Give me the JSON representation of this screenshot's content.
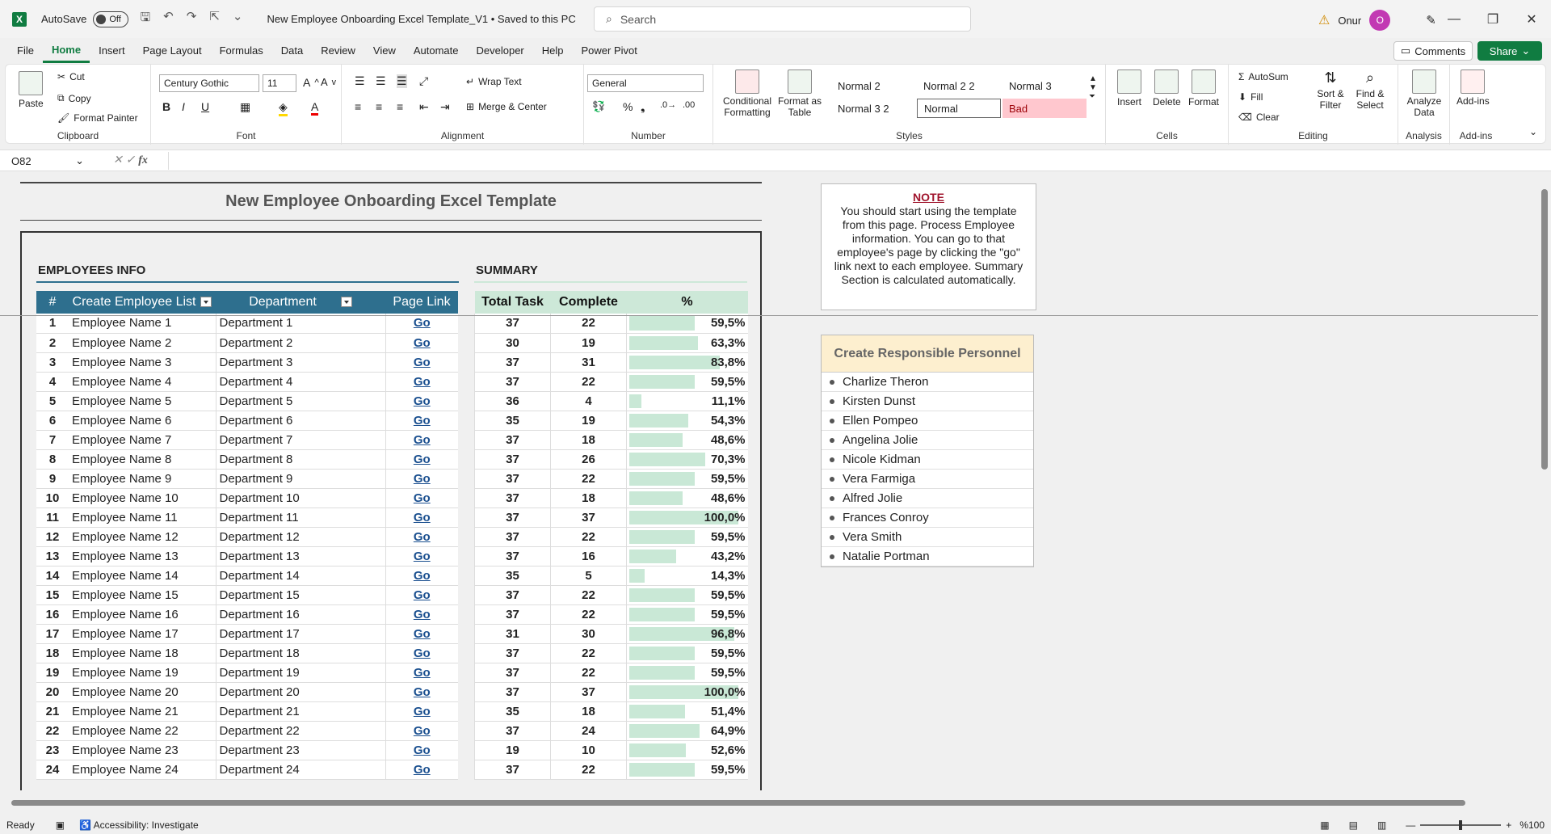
{
  "app": {
    "autosave_label": "AutoSave",
    "autosave_state": "Off",
    "doc_title": "New Employee Onboarding Excel Template_V1 • Saved to this PC",
    "search_placeholder": "Search",
    "user_name": "Onur",
    "user_initial": "O"
  },
  "menu": [
    "File",
    "Home",
    "Insert",
    "Page Layout",
    "Formulas",
    "Data",
    "Review",
    "View",
    "Automate",
    "Developer",
    "Help",
    "Power Pivot"
  ],
  "buttons": {
    "comments": "Comments",
    "share": "Share"
  },
  "ribbon": {
    "clipboard": {
      "label": "Clipboard",
      "paste": "Paste",
      "cut": "Cut",
      "copy": "Copy",
      "format_painter": "Format Painter"
    },
    "font": {
      "label": "Font",
      "family": "Century Gothic",
      "size": "11"
    },
    "alignment": {
      "label": "Alignment",
      "wrap": "Wrap Text",
      "merge": "Merge & Center"
    },
    "number": {
      "label": "Number",
      "format": "General"
    },
    "styles": {
      "label": "Styles",
      "conditional": "Conditional Formatting",
      "format_table": "Format as Table",
      "items": [
        "Normal 2",
        "Normal 2 2",
        "Normal 3",
        "Normal 3 2",
        "Normal",
        "Bad"
      ]
    },
    "cells": {
      "label": "Cells",
      "insert": "Insert",
      "delete": "Delete",
      "format": "Format"
    },
    "editing": {
      "label": "Editing",
      "autosum": "AutoSum",
      "fill": "Fill",
      "clear": "Clear",
      "sort": "Sort & Filter",
      "find": "Find & Select"
    },
    "analysis": {
      "label": "Analysis",
      "analyze": "Analyze Data"
    },
    "addins": {
      "label": "Add-ins",
      "addins": "Add-ins"
    }
  },
  "formula": {
    "cell_ref": "O82",
    "fx": "fx"
  },
  "sheet": {
    "title": "New Employee Onboarding Excel Template",
    "employees_title": "EMPLOYEES INFO",
    "summary_title": "SUMMARY",
    "emp_headers": [
      "#",
      "Create Employee List",
      "Department",
      "Page Link"
    ],
    "sum_headers": [
      "Total Task",
      "Complete",
      "%"
    ],
    "rows": [
      {
        "n": "1",
        "name": "Employee Name 1",
        "dept": "Department 1",
        "link": "Go",
        "total": "37",
        "complete": "22",
        "pct": "59,5%",
        "frac": 0.595
      },
      {
        "n": "2",
        "name": "Employee Name 2",
        "dept": "Department 2",
        "link": "Go",
        "total": "30",
        "complete": "19",
        "pct": "63,3%",
        "frac": 0.633
      },
      {
        "n": "3",
        "name": "Employee Name 3",
        "dept": "Department 3",
        "link": "Go",
        "total": "37",
        "complete": "31",
        "pct": "83,8%",
        "frac": 0.838
      },
      {
        "n": "4",
        "name": "Employee Name 4",
        "dept": "Department 4",
        "link": "Go",
        "total": "37",
        "complete": "22",
        "pct": "59,5%",
        "frac": 0.595
      },
      {
        "n": "5",
        "name": "Employee Name 5",
        "dept": "Department 5",
        "link": "Go",
        "total": "36",
        "complete": "4",
        "pct": "11,1%",
        "frac": 0.111
      },
      {
        "n": "6",
        "name": "Employee Name 6",
        "dept": "Department 6",
        "link": "Go",
        "total": "35",
        "complete": "19",
        "pct": "54,3%",
        "frac": 0.543
      },
      {
        "n": "7",
        "name": "Employee Name 7",
        "dept": "Department 7",
        "link": "Go",
        "total": "37",
        "complete": "18",
        "pct": "48,6%",
        "frac": 0.486
      },
      {
        "n": "8",
        "name": "Employee Name 8",
        "dept": "Department 8",
        "link": "Go",
        "total": "37",
        "complete": "26",
        "pct": "70,3%",
        "frac": 0.703
      },
      {
        "n": "9",
        "name": "Employee Name 9",
        "dept": "Department 9",
        "link": "Go",
        "total": "37",
        "complete": "22",
        "pct": "59,5%",
        "frac": 0.595
      },
      {
        "n": "10",
        "name": "Employee Name 10",
        "dept": "Department 10",
        "link": "Go",
        "total": "37",
        "complete": "18",
        "pct": "48,6%",
        "frac": 0.486
      },
      {
        "n": "11",
        "name": "Employee Name 11",
        "dept": "Department 11",
        "link": "Go",
        "total": "37",
        "complete": "37",
        "pct": "100,0%",
        "frac": 1.0
      },
      {
        "n": "12",
        "name": "Employee Name 12",
        "dept": "Department 12",
        "link": "Go",
        "total": "37",
        "complete": "22",
        "pct": "59,5%",
        "frac": 0.595
      },
      {
        "n": "13",
        "name": "Employee Name 13",
        "dept": "Department 13",
        "link": "Go",
        "total": "37",
        "complete": "16",
        "pct": "43,2%",
        "frac": 0.432
      },
      {
        "n": "14",
        "name": "Employee Name 14",
        "dept": "Department 14",
        "link": "Go",
        "total": "35",
        "complete": "5",
        "pct": "14,3%",
        "frac": 0.143
      },
      {
        "n": "15",
        "name": "Employee Name 15",
        "dept": "Department 15",
        "link": "Go",
        "total": "37",
        "complete": "22",
        "pct": "59,5%",
        "frac": 0.595
      },
      {
        "n": "16",
        "name": "Employee Name 16",
        "dept": "Department 16",
        "link": "Go",
        "total": "37",
        "complete": "22",
        "pct": "59,5%",
        "frac": 0.595
      },
      {
        "n": "17",
        "name": "Employee Name 17",
        "dept": "Department 17",
        "link": "Go",
        "total": "31",
        "complete": "30",
        "pct": "96,8%",
        "frac": 0.968
      },
      {
        "n": "18",
        "name": "Employee Name 18",
        "dept": "Department 18",
        "link": "Go",
        "total": "37",
        "complete": "22",
        "pct": "59,5%",
        "frac": 0.595
      },
      {
        "n": "19",
        "name": "Employee Name 19",
        "dept": "Department 19",
        "link": "Go",
        "total": "37",
        "complete": "22",
        "pct": "59,5%",
        "frac": 0.595
      },
      {
        "n": "20",
        "name": "Employee Name 20",
        "dept": "Department 20",
        "link": "Go",
        "total": "37",
        "complete": "37",
        "pct": "100,0%",
        "frac": 1.0
      },
      {
        "n": "21",
        "name": "Employee Name 21",
        "dept": "Department 21",
        "link": "Go",
        "total": "35",
        "complete": "18",
        "pct": "51,4%",
        "frac": 0.514
      },
      {
        "n": "22",
        "name": "Employee Name 22",
        "dept": "Department 22",
        "link": "Go",
        "total": "37",
        "complete": "24",
        "pct": "64,9%",
        "frac": 0.649
      },
      {
        "n": "23",
        "name": "Employee Name 23",
        "dept": "Department 23",
        "link": "Go",
        "total": "19",
        "complete": "10",
        "pct": "52,6%",
        "frac": 0.526
      },
      {
        "n": "24",
        "name": "Employee Name 24",
        "dept": "Department 24",
        "link": "Go",
        "total": "37",
        "complete": "22",
        "pct": "59,5%",
        "frac": 0.595
      }
    ],
    "note": {
      "title": "NOTE",
      "text": "You should start using the template from this page. Process Employee information. You can go to that employee's page by clicking the \"go\" link next to each employee. Summary Section is calculated automatically."
    },
    "responsible": {
      "title": "Create Responsible Personnel",
      "people": [
        "Charlize Theron",
        "Kirsten Dunst",
        "Ellen Pompeo",
        "Angelina Jolie",
        "Nicole Kidman",
        "Vera Farmiga",
        "Alfred Jolie",
        "Frances Conroy",
        "Vera Smith",
        "Natalie Portman"
      ]
    }
  },
  "status": {
    "ready": "Ready",
    "accessibility": "Accessibility: Investigate",
    "zoom": "%100"
  },
  "colors": {
    "accent": "#107c41",
    "header_blue": "#2e6f8e",
    "summary_green": "#cde8d8",
    "bar_green": "#c9e8d6",
    "bad_pink": "#ffc7ce"
  }
}
